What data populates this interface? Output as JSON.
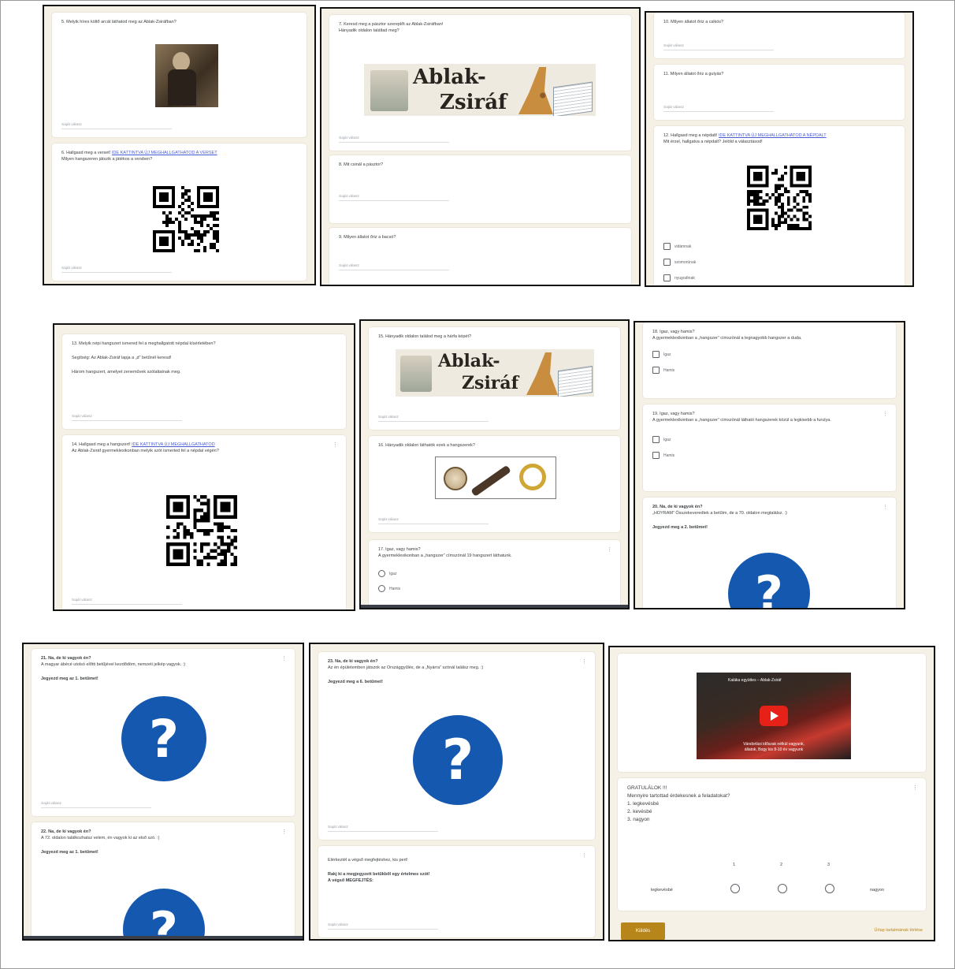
{
  "icons": {
    "qr": "qr-code",
    "question": "question-mark-icon",
    "play": "play-button-icon"
  },
  "colors": {
    "accent": "#b6861a",
    "question_blue": "#1558b0",
    "link": "#4a5bd6",
    "page_bg": "#f6f1e6"
  },
  "p1": {
    "q5": "5. Melyik híres költő arcát láthatod meg az Ablak-Zsiráfban?",
    "q6_a": "6. Hallgasd meg a verset!",
    "q6_link": "IDE KATTINTVA ÚJ MEGHALLGATHATOD A VERSET",
    "q6_b": "Milyen hangszeren játszik a játékos a versben?",
    "answer": "Saját válasz"
  },
  "p2": {
    "q7_a": "7. Keresd meg a pásztor szereplőt az Ablak-Zsiráfban!",
    "q7_b": "Hányadik oldalon találtad meg?",
    "banner_1": "Ablak-",
    "banner_2": "Zsiráf",
    "q8": "8. Mit csinál a pásztor?",
    "q9": "9. Milyen állatot őriz a bacsó?",
    "answer": "Saját válasz"
  },
  "p3": {
    "q10": "10. Milyen állatot őriz a csikós?",
    "q11": "11. Milyen állatot őriz a gulyás?",
    "q12_a": "12. Hallgasd meg a népdalt!",
    "q12_link": "IDE KATTINTVA ÚJ MEGHALLGATHATOD A NÉPDALT",
    "q12_b": "Mit érzel, hallgatva a népdalt? Jelöld a választásod!",
    "options": [
      "vidámnak",
      "szomorúnak",
      "nyugodtnak"
    ],
    "answer": "Saját válasz"
  },
  "p4": {
    "q13": "13. Melyik népi hangszert ismered fel a meghallgatott népdal kísérletében?",
    "hint_1": "Segítség: Az Ablak-Zsiráf lapja a „d” betűnél keresd!",
    "hint_2": "Három hangszert, amelyet zeneművek szólaltatnak meg.",
    "q14_a": "14. Hallgasd meg a hangszert!",
    "q14_link": "IDE KATTINTVA ÚJ MEGHALLGATHATOD",
    "q14_b": "Az Ablak-Zsiráf gyermeklexikonban melyik szót ismerted fel a népdal végén?",
    "answer": "Saját válasz"
  },
  "p5": {
    "q15": "15. Hányadik oldalon találod meg a hárfa képét?",
    "banner_1": "Ablak-",
    "banner_2": "Zsiráf",
    "q16": "16. Hányadik oldalon láthatók ezek a hangszerek?",
    "q17_a": "17. Igaz, vagy hamis?",
    "q17_b": "A gyermeklexikonban a „hangszer” címszónál 19 hangszert láthatunk.",
    "opt_true": "Igaz",
    "opt_false": "Hamis",
    "answer": "Saját válasz"
  },
  "p6": {
    "q18_a": "18. Igaz, vagy hamis?",
    "q18_b": "A gyermeklexikonban a „hangszer” címszónál a legnagyobb hangszer a duda.",
    "q19_a": "19. Igaz, vagy hamis?",
    "q19_b": "A gyermeklexikonban a „hangszer” címszónál látható hangszerek közül a legkisebb a furulya.",
    "opt_true": "Igaz",
    "opt_false": "Hamis",
    "q20_a": "20. Na, de ki vagyok én?",
    "q20_b": "„HOYRAM” Összekeveredtek a betűim, de a 70. oldalon megtalálsz. :)",
    "q20_c": "Jegyezd meg a 2. betűmet!"
  },
  "p7": {
    "q21_a": "21. Na, de ki vagyok én?",
    "q21_b": "A magyar ábécé utolsó előtti betűjével kezdődöm, nemzeti jelkép vagyok. :)",
    "q21_c": "Jegyezd meg az 1. betűmet!",
    "q22_a": "22. Na, de ki vagyok én?",
    "q22_b": "A 72. oldalon találkozhatsz velem, én vagyok ki az első szó. :)",
    "q22_c": "Jegyezd meg az 1. betűmet!",
    "answer": "Saját válasz"
  },
  "p8": {
    "q23_a": "23. Na, de ki vagyok én?",
    "q23_b": "Az én épületemben játszok az Országgyűlés, de a „Nyárra” szónál találsz meg. :)",
    "q23_c": "Jegyezd meg a 6. betűmet!",
    "q24_a": "Elérkeztél a végső megfejtéshez, kis pert!",
    "q24_b": "Rakj ki a megjegyzett betűkből egy értelmes szót!",
    "q24_c": "A végső MEGFEJTÉS:",
    "answer": "Saját válasz"
  },
  "p9": {
    "video_title": "Kaláka együttes – Ablak-Zsiráf",
    "video_caption_1": "Vándorlási időszak nélkül vagyunk,",
    "video_caption_2": "állatok, Bogy kis 8-10 év vagyunk",
    "congrats": "GRATULÁLOK !!!",
    "question": "Mennyire tartottad érdekesnek a feladatokat?",
    "scale_1": "1. legkevésbé",
    "scale_2": "2. kevésbé",
    "scale_3": "3. nagyon",
    "col_1": "1",
    "col_2": "2",
    "col_3": "3",
    "label_low": "legkevésbé",
    "label_high": "nagyon",
    "submit": "Küldés",
    "clear": "Űrlap tartalmának törlése"
  }
}
